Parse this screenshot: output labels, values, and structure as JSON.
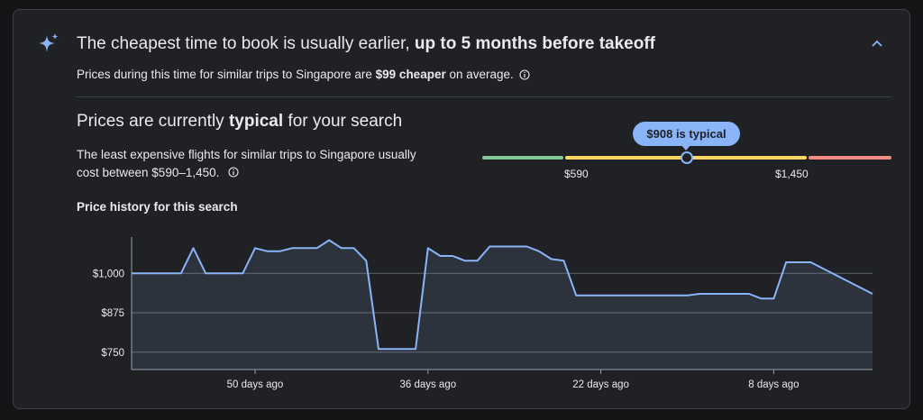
{
  "insight": {
    "headline_prefix": "The cheapest time to book is usually earlier, ",
    "headline_bold": "up to 5 months before takeoff",
    "sub_prefix": "Prices during this time for similar trips to Singapore are ",
    "sub_bold": "$99 cheaper",
    "sub_suffix": " on average."
  },
  "price_status": {
    "title_prefix": "Prices are currently ",
    "title_bold": "typical",
    "title_suffix": " for your search",
    "description": "The least expensive flights for similar trips to Singapore usually cost between $590–1,450.",
    "bubble": "$908 is typical",
    "range_low_label": "$590",
    "range_high_label": "$1,450",
    "typical_price": 908,
    "range_low": 590,
    "range_high": 1450,
    "colors": {
      "low": "#81c995",
      "typical": "#fdd663",
      "high": "#f28b82",
      "accent": "#8ab4f8"
    }
  },
  "history": {
    "title": "Price history for this search"
  },
  "icons": [
    "sparkle-icon",
    "chevron-up-icon",
    "info-icon"
  ],
  "chart_data": {
    "type": "line",
    "xlabel": "",
    "ylabel": "",
    "x_ticks": [
      50,
      36,
      22,
      8
    ],
    "x_tick_labels": [
      "50 days ago",
      "36 days ago",
      "22 days ago",
      "8 days ago"
    ],
    "y_ticks": [
      750,
      875,
      1000
    ],
    "y_tick_labels": [
      "$750",
      "$875",
      "$1,000"
    ],
    "ylim": [
      695,
      1115
    ],
    "xlim": [
      60,
      0
    ],
    "grid": true,
    "series": [
      {
        "x": [
          60,
          56,
          55,
          54,
          53,
          52,
          51,
          50,
          49,
          48,
          47,
          46,
          45,
          44,
          43,
          42,
          41,
          40,
          39,
          38,
          37,
          36,
          35,
          34,
          33,
          32,
          31,
          30,
          29,
          28,
          27,
          26,
          25,
          24,
          16,
          15,
          14,
          13,
          12,
          11,
          10,
          9,
          8,
          7,
          6,
          5,
          0
        ],
        "values": [
          1000,
          1000,
          1080,
          1000,
          1000,
          1000,
          1000,
          1080,
          1070,
          1070,
          1080,
          1080,
          1080,
          1105,
          1080,
          1080,
          1040,
          760,
          760,
          760,
          760,
          1080,
          1055,
          1055,
          1040,
          1040,
          1085,
          1085,
          1085,
          1085,
          1070,
          1045,
          1040,
          930,
          930,
          930,
          935,
          935,
          935,
          935,
          935,
          920,
          920,
          1035,
          1035,
          1035,
          935
        ]
      }
    ]
  }
}
